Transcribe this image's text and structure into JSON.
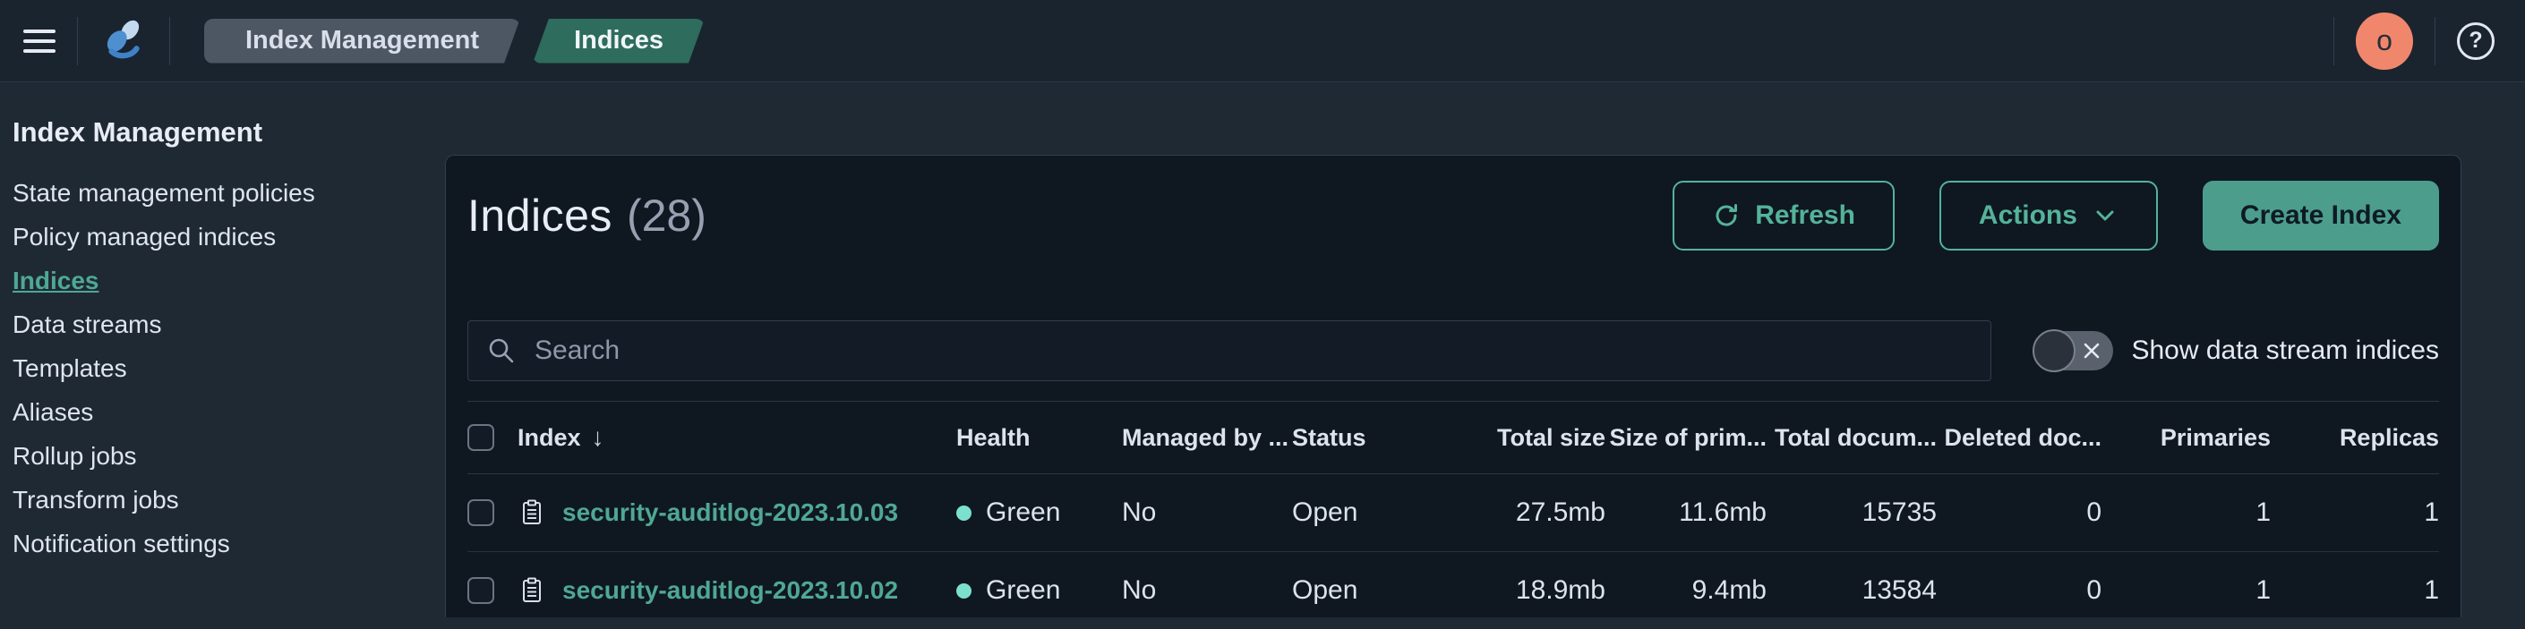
{
  "colors": {
    "accent": "#54B399",
    "accent_fill": "#4C9D8C",
    "link": "#4FA893",
    "health_green": "#7CE0CF",
    "avatar_bg": "#F0876C",
    "breadcrumb_bg": "#4D5764",
    "breadcrumb_active_bg": "#2E6C5D"
  },
  "topbar": {
    "breadcrumbs": [
      {
        "label": "Index Management"
      },
      {
        "label": "Indices"
      }
    ],
    "avatar_initial": "o",
    "help_glyph": "?"
  },
  "sidebar": {
    "title": "Index Management",
    "items": [
      {
        "label": "State management policies",
        "active": false
      },
      {
        "label": "Policy managed indices",
        "active": false
      },
      {
        "label": "Indices",
        "active": true
      },
      {
        "label": "Data streams",
        "active": false
      },
      {
        "label": "Templates",
        "active": false
      },
      {
        "label": "Aliases",
        "active": false
      },
      {
        "label": "Rollup jobs",
        "active": false
      },
      {
        "label": "Transform jobs",
        "active": false
      },
      {
        "label": "Notification settings",
        "active": false
      }
    ]
  },
  "main": {
    "title": "Indices",
    "count": "(28)",
    "toolbar": {
      "refresh_label": "Refresh",
      "actions_label": "Actions",
      "create_label": "Create Index"
    },
    "search": {
      "placeholder": "Search",
      "value": ""
    },
    "toggle": {
      "label": "Show data stream indices",
      "state": "off"
    },
    "table": {
      "sort_icon": "↓",
      "columns": [
        "Index",
        "Health",
        "Managed by ...",
        "Status",
        "Total size",
        "Size of prim...",
        "Total docum...",
        "Deleted doc...",
        "Primaries",
        "Replicas"
      ],
      "rows": [
        {
          "name": "security-auditlog-2023.10.03",
          "health": "Green",
          "managed_by": "No",
          "status": "Open",
          "total_size": "27.5mb",
          "size_of_primaries": "11.6mb",
          "total_documents": "15735",
          "deleted_documents": "0",
          "primaries": "1",
          "replicas": "1"
        },
        {
          "name": "security-auditlog-2023.10.02",
          "health": "Green",
          "managed_by": "No",
          "status": "Open",
          "total_size": "18.9mb",
          "size_of_primaries": "9.4mb",
          "total_documents": "13584",
          "deleted_documents": "0",
          "primaries": "1",
          "replicas": "1"
        }
      ]
    }
  }
}
